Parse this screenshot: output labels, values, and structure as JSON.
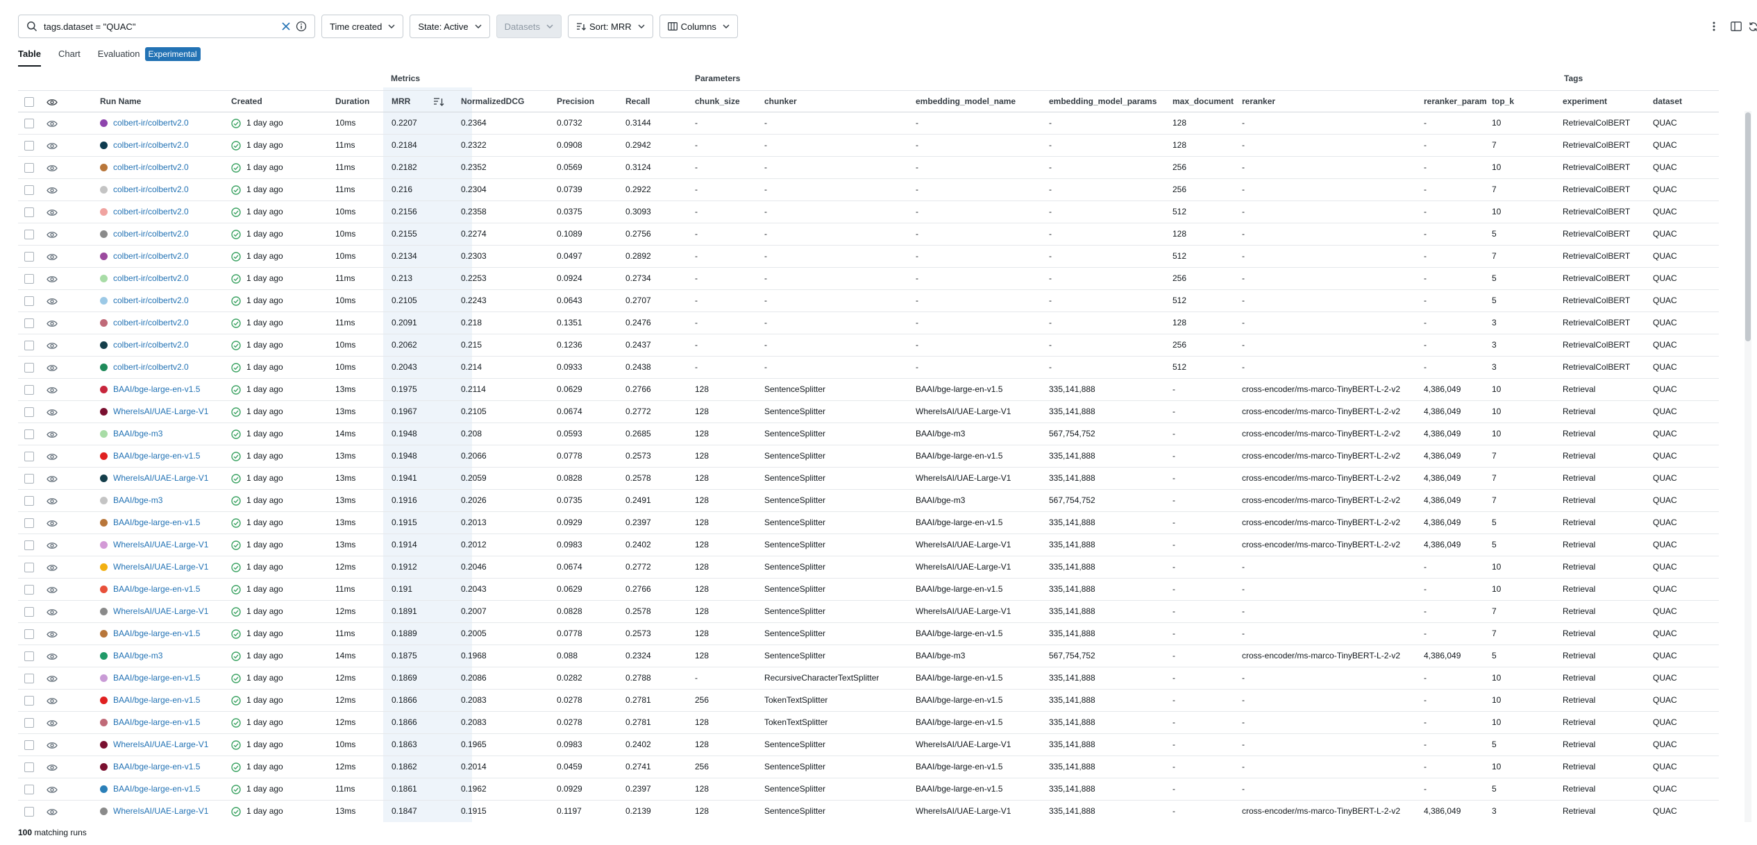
{
  "search": {
    "query": "tags.dataset = \"QUAC\""
  },
  "filters": {
    "time_created": "Time created",
    "state": "State: Active",
    "datasets": "Datasets",
    "sort": "Sort: MRR",
    "columns": "Columns"
  },
  "tabs": [
    "Table",
    "Chart",
    "Evaluation"
  ],
  "experimental_badge": "Experimental",
  "column_groups": {
    "metrics": "Metrics",
    "parameters": "Parameters",
    "tags": "Tags"
  },
  "columns": [
    "Run Name",
    "Created",
    "Duration",
    "MRR",
    "NormalizedDCG",
    "Precision",
    "Recall",
    "chunk_size",
    "chunker",
    "embedding_model_name",
    "embedding_model_params",
    "max_document",
    "reranker",
    "reranker_param",
    "top_k",
    "experiment",
    "dataset"
  ],
  "rows": [
    {
      "color": "#8e44ad",
      "run": "colbert-ir/colbertv2.0",
      "created": "1 day ago",
      "dur": "10ms",
      "mrr": "0.2207",
      "ndcg": "0.2364",
      "prec": "0.0732",
      "rec": "0.3144",
      "chunk": "-",
      "chunker": "-",
      "emb": "-",
      "embp": "-",
      "maxd": "128",
      "rer": "-",
      "rerp": "-",
      "topk": "10",
      "exp": "RetrievalColBERT",
      "ds": "QUAC"
    },
    {
      "color": "#0d3b4f",
      "run": "colbert-ir/colbertv2.0",
      "created": "1 day ago",
      "dur": "11ms",
      "mrr": "0.2184",
      "ndcg": "0.2322",
      "prec": "0.0908",
      "rec": "0.2942",
      "chunk": "-",
      "chunker": "-",
      "emb": "-",
      "embp": "-",
      "maxd": "128",
      "rer": "-",
      "rerp": "-",
      "topk": "7",
      "exp": "RetrievalColBERT",
      "ds": "QUAC"
    },
    {
      "color": "#b8763a",
      "run": "colbert-ir/colbertv2.0",
      "created": "1 day ago",
      "dur": "11ms",
      "mrr": "0.2182",
      "ndcg": "0.2352",
      "prec": "0.0569",
      "rec": "0.3124",
      "chunk": "-",
      "chunker": "-",
      "emb": "-",
      "embp": "-",
      "maxd": "256",
      "rer": "-",
      "rerp": "-",
      "topk": "10",
      "exp": "RetrievalColBERT",
      "ds": "QUAC"
    },
    {
      "color": "#c4c4c4",
      "run": "colbert-ir/colbertv2.0",
      "created": "1 day ago",
      "dur": "11ms",
      "mrr": "0.216",
      "ndcg": "0.2304",
      "prec": "0.0739",
      "rec": "0.2922",
      "chunk": "-",
      "chunker": "-",
      "emb": "-",
      "embp": "-",
      "maxd": "256",
      "rer": "-",
      "rerp": "-",
      "topk": "7",
      "exp": "RetrievalColBERT",
      "ds": "QUAC"
    },
    {
      "color": "#f0a3a0",
      "run": "colbert-ir/colbertv2.0",
      "created": "1 day ago",
      "dur": "10ms",
      "mrr": "0.2156",
      "ndcg": "0.2358",
      "prec": "0.0375",
      "rec": "0.3093",
      "chunk": "-",
      "chunker": "-",
      "emb": "-",
      "embp": "-",
      "maxd": "512",
      "rer": "-",
      "rerp": "-",
      "topk": "10",
      "exp": "RetrievalColBERT",
      "ds": "QUAC"
    },
    {
      "color": "#8a8a8a",
      "run": "colbert-ir/colbertv2.0",
      "created": "1 day ago",
      "dur": "10ms",
      "mrr": "0.2155",
      "ndcg": "0.2274",
      "prec": "0.1089",
      "rec": "0.2756",
      "chunk": "-",
      "chunker": "-",
      "emb": "-",
      "embp": "-",
      "maxd": "128",
      "rer": "-",
      "rerp": "-",
      "topk": "5",
      "exp": "RetrievalColBERT",
      "ds": "QUAC"
    },
    {
      "color": "#9b4a9e",
      "run": "colbert-ir/colbertv2.0",
      "created": "1 day ago",
      "dur": "10ms",
      "mrr": "0.2134",
      "ndcg": "0.2303",
      "prec": "0.0497",
      "rec": "0.2892",
      "chunk": "-",
      "chunker": "-",
      "emb": "-",
      "embp": "-",
      "maxd": "512",
      "rer": "-",
      "rerp": "-",
      "topk": "7",
      "exp": "RetrievalColBERT",
      "ds": "QUAC"
    },
    {
      "color": "#a8dca6",
      "run": "colbert-ir/colbertv2.0",
      "created": "1 day ago",
      "dur": "11ms",
      "mrr": "0.213",
      "ndcg": "0.2253",
      "prec": "0.0924",
      "rec": "0.2734",
      "chunk": "-",
      "chunker": "-",
      "emb": "-",
      "embp": "-",
      "maxd": "256",
      "rer": "-",
      "rerp": "-",
      "topk": "5",
      "exp": "RetrievalColBERT",
      "ds": "QUAC"
    },
    {
      "color": "#9cc9e6",
      "run": "colbert-ir/colbertv2.0",
      "created": "1 day ago",
      "dur": "10ms",
      "mrr": "0.2105",
      "ndcg": "0.2243",
      "prec": "0.0643",
      "rec": "0.2707",
      "chunk": "-",
      "chunker": "-",
      "emb": "-",
      "embp": "-",
      "maxd": "512",
      "rer": "-",
      "rerp": "-",
      "topk": "5",
      "exp": "RetrievalColBERT",
      "ds": "QUAC"
    },
    {
      "color": "#c06a78",
      "run": "colbert-ir/colbertv2.0",
      "created": "1 day ago",
      "dur": "11ms",
      "mrr": "0.2091",
      "ndcg": "0.218",
      "prec": "0.1351",
      "rec": "0.2476",
      "chunk": "-",
      "chunker": "-",
      "emb": "-",
      "embp": "-",
      "maxd": "128",
      "rer": "-",
      "rerp": "-",
      "topk": "3",
      "exp": "RetrievalColBERT",
      "ds": "QUAC"
    },
    {
      "color": "#143e4a",
      "run": "colbert-ir/colbertv2.0",
      "created": "1 day ago",
      "dur": "10ms",
      "mrr": "0.2062",
      "ndcg": "0.215",
      "prec": "0.1236",
      "rec": "0.2437",
      "chunk": "-",
      "chunker": "-",
      "emb": "-",
      "embp": "-",
      "maxd": "256",
      "rer": "-",
      "rerp": "-",
      "topk": "3",
      "exp": "RetrievalColBERT",
      "ds": "QUAC"
    },
    {
      "color": "#1f8a5a",
      "run": "colbert-ir/colbertv2.0",
      "created": "1 day ago",
      "dur": "10ms",
      "mrr": "0.2043",
      "ndcg": "0.214",
      "prec": "0.0933",
      "rec": "0.2438",
      "chunk": "-",
      "chunker": "-",
      "emb": "-",
      "embp": "-",
      "maxd": "512",
      "rer": "-",
      "rerp": "-",
      "topk": "3",
      "exp": "RetrievalColBERT",
      "ds": "QUAC"
    },
    {
      "color": "#c7263c",
      "run": "BAAI/bge-large-en-v1.5",
      "created": "1 day ago",
      "dur": "13ms",
      "mrr": "0.1975",
      "ndcg": "0.2114",
      "prec": "0.0629",
      "rec": "0.2766",
      "chunk": "128",
      "chunker": "SentenceSplitter",
      "emb": "BAAI/bge-large-en-v1.5",
      "embp": "335,141,888",
      "maxd": "-",
      "rer": "cross-encoder/ms-marco-TinyBERT-L-2-v2",
      "rerp": "4,386,049",
      "topk": "10",
      "exp": "Retrieval",
      "ds": "QUAC"
    },
    {
      "color": "#7a1030",
      "run": "WhereIsAI/UAE-Large-V1",
      "created": "1 day ago",
      "dur": "13ms",
      "mrr": "0.1967",
      "ndcg": "0.2105",
      "prec": "0.0674",
      "rec": "0.2772",
      "chunk": "128",
      "chunker": "SentenceSplitter",
      "emb": "WhereIsAI/UAE-Large-V1",
      "embp": "335,141,888",
      "maxd": "-",
      "rer": "cross-encoder/ms-marco-TinyBERT-L-2-v2",
      "rerp": "4,386,049",
      "topk": "10",
      "exp": "Retrieval",
      "ds": "QUAC"
    },
    {
      "color": "#a8dca6",
      "run": "BAAI/bge-m3",
      "created": "1 day ago",
      "dur": "14ms",
      "mrr": "0.1948",
      "ndcg": "0.208",
      "prec": "0.0593",
      "rec": "0.2685",
      "chunk": "128",
      "chunker": "SentenceSplitter",
      "emb": "BAAI/bge-m3",
      "embp": "567,754,752",
      "maxd": "-",
      "rer": "cross-encoder/ms-marco-TinyBERT-L-2-v2",
      "rerp": "4,386,049",
      "topk": "10",
      "exp": "Retrieval",
      "ds": "QUAC"
    },
    {
      "color": "#e02020",
      "run": "BAAI/bge-large-en-v1.5",
      "created": "1 day ago",
      "dur": "13ms",
      "mrr": "0.1948",
      "ndcg": "0.2066",
      "prec": "0.0778",
      "rec": "0.2573",
      "chunk": "128",
      "chunker": "SentenceSplitter",
      "emb": "BAAI/bge-large-en-v1.5",
      "embp": "335,141,888",
      "maxd": "-",
      "rer": "cross-encoder/ms-marco-TinyBERT-L-2-v2",
      "rerp": "4,386,049",
      "topk": "7",
      "exp": "Retrieval",
      "ds": "QUAC"
    },
    {
      "color": "#143e4a",
      "run": "WhereIsAI/UAE-Large-V1",
      "created": "1 day ago",
      "dur": "13ms",
      "mrr": "0.1941",
      "ndcg": "0.2059",
      "prec": "0.0828",
      "rec": "0.2578",
      "chunk": "128",
      "chunker": "SentenceSplitter",
      "emb": "WhereIsAI/UAE-Large-V1",
      "embp": "335,141,888",
      "maxd": "-",
      "rer": "cross-encoder/ms-marco-TinyBERT-L-2-v2",
      "rerp": "4,386,049",
      "topk": "7",
      "exp": "Retrieval",
      "ds": "QUAC"
    },
    {
      "color": "#c4c4c4",
      "run": "BAAI/bge-m3",
      "created": "1 day ago",
      "dur": "13ms",
      "mrr": "0.1916",
      "ndcg": "0.2026",
      "prec": "0.0735",
      "rec": "0.2491",
      "chunk": "128",
      "chunker": "SentenceSplitter",
      "emb": "BAAI/bge-m3",
      "embp": "567,754,752",
      "maxd": "-",
      "rer": "cross-encoder/ms-marco-TinyBERT-L-2-v2",
      "rerp": "4,386,049",
      "topk": "7",
      "exp": "Retrieval",
      "ds": "QUAC"
    },
    {
      "color": "#b8763a",
      "run": "BAAI/bge-large-en-v1.5",
      "created": "1 day ago",
      "dur": "13ms",
      "mrr": "0.1915",
      "ndcg": "0.2013",
      "prec": "0.0929",
      "rec": "0.2397",
      "chunk": "128",
      "chunker": "SentenceSplitter",
      "emb": "BAAI/bge-large-en-v1.5",
      "embp": "335,141,888",
      "maxd": "-",
      "rer": "cross-encoder/ms-marco-TinyBERT-L-2-v2",
      "rerp": "4,386,049",
      "topk": "5",
      "exp": "Retrieval",
      "ds": "QUAC"
    },
    {
      "color": "#d39ad6",
      "run": "WhereIsAI/UAE-Large-V1",
      "created": "1 day ago",
      "dur": "13ms",
      "mrr": "0.1914",
      "ndcg": "0.2012",
      "prec": "0.0983",
      "rec": "0.2402",
      "chunk": "128",
      "chunker": "SentenceSplitter",
      "emb": "WhereIsAI/UAE-Large-V1",
      "embp": "335,141,888",
      "maxd": "-",
      "rer": "cross-encoder/ms-marco-TinyBERT-L-2-v2",
      "rerp": "4,386,049",
      "topk": "5",
      "exp": "Retrieval",
      "ds": "QUAC"
    },
    {
      "color": "#f2b011",
      "run": "WhereIsAI/UAE-Large-V1",
      "created": "1 day ago",
      "dur": "12ms",
      "mrr": "0.1912",
      "ndcg": "0.2046",
      "prec": "0.0674",
      "rec": "0.2772",
      "chunk": "128",
      "chunker": "SentenceSplitter",
      "emb": "WhereIsAI/UAE-Large-V1",
      "embp": "335,141,888",
      "maxd": "-",
      "rer": "-",
      "rerp": "-",
      "topk": "10",
      "exp": "Retrieval",
      "ds": "QUAC"
    },
    {
      "color": "#e8503a",
      "run": "BAAI/bge-large-en-v1.5",
      "created": "1 day ago",
      "dur": "11ms",
      "mrr": "0.191",
      "ndcg": "0.2043",
      "prec": "0.0629",
      "rec": "0.2766",
      "chunk": "128",
      "chunker": "SentenceSplitter",
      "emb": "BAAI/bge-large-en-v1.5",
      "embp": "335,141,888",
      "maxd": "-",
      "rer": "-",
      "rerp": "-",
      "topk": "10",
      "exp": "Retrieval",
      "ds": "QUAC"
    },
    {
      "color": "#8a8a8a",
      "run": "WhereIsAI/UAE-Large-V1",
      "created": "1 day ago",
      "dur": "12ms",
      "mrr": "0.1891",
      "ndcg": "0.2007",
      "prec": "0.0828",
      "rec": "0.2578",
      "chunk": "128",
      "chunker": "SentenceSplitter",
      "emb": "WhereIsAI/UAE-Large-V1",
      "embp": "335,141,888",
      "maxd": "-",
      "rer": "-",
      "rerp": "-",
      "topk": "7",
      "exp": "Retrieval",
      "ds": "QUAC"
    },
    {
      "color": "#b8763a",
      "run": "BAAI/bge-large-en-v1.5",
      "created": "1 day ago",
      "dur": "11ms",
      "mrr": "0.1889",
      "ndcg": "0.2005",
      "prec": "0.0778",
      "rec": "0.2573",
      "chunk": "128",
      "chunker": "SentenceSplitter",
      "emb": "BAAI/bge-large-en-v1.5",
      "embp": "335,141,888",
      "maxd": "-",
      "rer": "-",
      "rerp": "-",
      "topk": "7",
      "exp": "Retrieval",
      "ds": "QUAC"
    },
    {
      "color": "#1f9a68",
      "run": "BAAI/bge-m3",
      "created": "1 day ago",
      "dur": "14ms",
      "mrr": "0.1875",
      "ndcg": "0.1968",
      "prec": "0.088",
      "rec": "0.2324",
      "chunk": "128",
      "chunker": "SentenceSplitter",
      "emb": "BAAI/bge-m3",
      "embp": "567,754,752",
      "maxd": "-",
      "rer": "cross-encoder/ms-marco-TinyBERT-L-2-v2",
      "rerp": "4,386,049",
      "topk": "5",
      "exp": "Retrieval",
      "ds": "QUAC"
    },
    {
      "color": "#c99bd6",
      "run": "BAAI/bge-large-en-v1.5",
      "created": "1 day ago",
      "dur": "12ms",
      "mrr": "0.1869",
      "ndcg": "0.2086",
      "prec": "0.0282",
      "rec": "0.2788",
      "chunk": "-",
      "chunker": "RecursiveCharacterTextSplitter",
      "emb": "BAAI/bge-large-en-v1.5",
      "embp": "335,141,888",
      "maxd": "-",
      "rer": "-",
      "rerp": "-",
      "topk": "10",
      "exp": "Retrieval",
      "ds": "QUAC"
    },
    {
      "color": "#e02020",
      "run": "BAAI/bge-large-en-v1.5",
      "created": "1 day ago",
      "dur": "12ms",
      "mrr": "0.1866",
      "ndcg": "0.2083",
      "prec": "0.0278",
      "rec": "0.2781",
      "chunk": "256",
      "chunker": "TokenTextSplitter",
      "emb": "BAAI/bge-large-en-v1.5",
      "embp": "335,141,888",
      "maxd": "-",
      "rer": "-",
      "rerp": "-",
      "topk": "10",
      "exp": "Retrieval",
      "ds": "QUAC"
    },
    {
      "color": "#c06a78",
      "run": "BAAI/bge-large-en-v1.5",
      "created": "1 day ago",
      "dur": "12ms",
      "mrr": "0.1866",
      "ndcg": "0.2083",
      "prec": "0.0278",
      "rec": "0.2781",
      "chunk": "128",
      "chunker": "TokenTextSplitter",
      "emb": "BAAI/bge-large-en-v1.5",
      "embp": "335,141,888",
      "maxd": "-",
      "rer": "-",
      "rerp": "-",
      "topk": "10",
      "exp": "Retrieval",
      "ds": "QUAC"
    },
    {
      "color": "#7a1030",
      "run": "WhereIsAI/UAE-Large-V1",
      "created": "1 day ago",
      "dur": "10ms",
      "mrr": "0.1863",
      "ndcg": "0.1965",
      "prec": "0.0983",
      "rec": "0.2402",
      "chunk": "128",
      "chunker": "SentenceSplitter",
      "emb": "WhereIsAI/UAE-Large-V1",
      "embp": "335,141,888",
      "maxd": "-",
      "rer": "-",
      "rerp": "-",
      "topk": "5",
      "exp": "Retrieval",
      "ds": "QUAC"
    },
    {
      "color": "#7a1030",
      "run": "BAAI/bge-large-en-v1.5",
      "created": "1 day ago",
      "dur": "12ms",
      "mrr": "0.1862",
      "ndcg": "0.2014",
      "prec": "0.0459",
      "rec": "0.2741",
      "chunk": "256",
      "chunker": "SentenceSplitter",
      "emb": "BAAI/bge-large-en-v1.5",
      "embp": "335,141,888",
      "maxd": "-",
      "rer": "-",
      "rerp": "-",
      "topk": "10",
      "exp": "Retrieval",
      "ds": "QUAC"
    },
    {
      "color": "#2a7fb8",
      "run": "BAAI/bge-large-en-v1.5",
      "created": "1 day ago",
      "dur": "11ms",
      "mrr": "0.1861",
      "ndcg": "0.1962",
      "prec": "0.0929",
      "rec": "0.2397",
      "chunk": "128",
      "chunker": "SentenceSplitter",
      "emb": "BAAI/bge-large-en-v1.5",
      "embp": "335,141,888",
      "maxd": "-",
      "rer": "-",
      "rerp": "-",
      "topk": "5",
      "exp": "Retrieval",
      "ds": "QUAC"
    },
    {
      "color": "#8a8a8a",
      "run": "WhereIsAI/UAE-Large-V1",
      "created": "1 day ago",
      "dur": "13ms",
      "mrr": "0.1847",
      "ndcg": "0.1915",
      "prec": "0.1197",
      "rec": "0.2139",
      "chunk": "128",
      "chunker": "SentenceSplitter",
      "emb": "WhereIsAI/UAE-Large-V1",
      "embp": "335,141,888",
      "maxd": "-",
      "rer": "cross-encoder/ms-marco-TinyBERT-L-2-v2",
      "rerp": "4,386,049",
      "topk": "3",
      "exp": "Retrieval",
      "ds": "QUAC"
    }
  ],
  "footer": {
    "count": "100",
    "label": "matching runs"
  }
}
